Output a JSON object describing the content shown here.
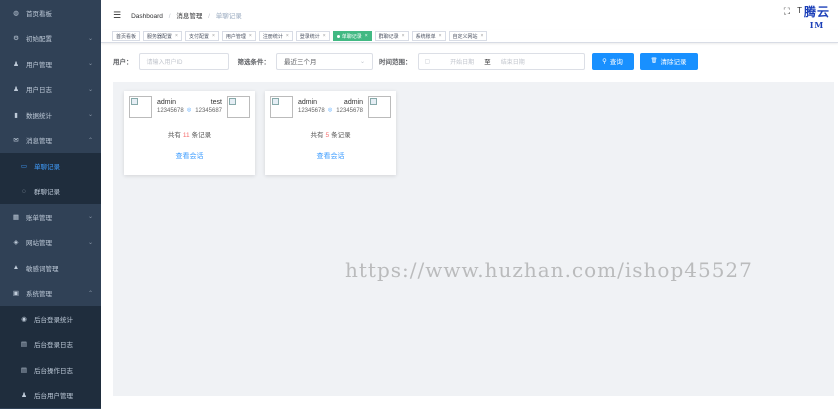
{
  "sidebar": {
    "items": [
      {
        "label": "首页看板",
        "icon": "dashboard-icon",
        "glyph": "◍",
        "chevron": ""
      },
      {
        "label": "初始配置",
        "icon": "settings-icon",
        "glyph": "⚙",
        "chevron": "⌄"
      },
      {
        "label": "用户管理",
        "icon": "user-icon",
        "glyph": "♟",
        "chevron": "⌄"
      },
      {
        "label": "用户日志",
        "icon": "user-log-icon",
        "glyph": "♟",
        "chevron": "⌄"
      },
      {
        "label": "数据统计",
        "icon": "chart-icon",
        "glyph": "▮",
        "chevron": "⌄"
      },
      {
        "label": "消息管理",
        "icon": "message-icon",
        "glyph": "✉",
        "chevron": "⌃"
      },
      {
        "label": "单聊记录",
        "icon": "chat-icon",
        "glyph": "▭",
        "chevron": "",
        "sub": true,
        "active": true
      },
      {
        "label": "群聊记录",
        "icon": "group-chat-icon",
        "glyph": "◌",
        "chevron": "",
        "sub": true
      },
      {
        "label": "账单管理",
        "icon": "bill-icon",
        "glyph": "▦",
        "chevron": "⌄"
      },
      {
        "label": "网站管理",
        "icon": "website-icon",
        "glyph": "◈",
        "chevron": "⌄"
      },
      {
        "label": "敏感词管理",
        "icon": "warning-icon",
        "glyph": "▲",
        "chevron": ""
      },
      {
        "label": "系统管理",
        "icon": "system-icon",
        "glyph": "▣",
        "chevron": "⌃"
      },
      {
        "label": "后台登录统计",
        "icon": "login-stat-icon",
        "glyph": "◉",
        "chevron": "",
        "sub": true
      },
      {
        "label": "后台登录日志",
        "icon": "login-log-icon",
        "glyph": "▤",
        "chevron": "",
        "sub": true
      },
      {
        "label": "后台操作日志",
        "icon": "operation-log-icon",
        "glyph": "▤",
        "chevron": "",
        "sub": true
      },
      {
        "label": "后台用户管理",
        "icon": "admin-user-icon",
        "glyph": "♟",
        "chevron": "",
        "sub": true
      }
    ]
  },
  "navbar": {
    "hamburger": "☰",
    "breadcrumb": [
      "Dashboard",
      "消息管理",
      "单聊记录"
    ],
    "sep": "/",
    "fullscreen": "⛶",
    "textsize": "T",
    "brand_line1": "腾云",
    "brand_line2": "IM"
  },
  "tags": [
    {
      "label": "首页看板",
      "close": ""
    },
    {
      "label": "服务器配置",
      "close": "×"
    },
    {
      "label": "支付配置",
      "close": "×"
    },
    {
      "label": "用户管理",
      "close": "×"
    },
    {
      "label": "注册统计",
      "close": "×"
    },
    {
      "label": "登录统计",
      "close": "×"
    },
    {
      "label": "单聊记录",
      "close": "×",
      "active": true
    },
    {
      "label": "群聊记录",
      "close": "×"
    },
    {
      "label": "系统账单",
      "close": "×"
    },
    {
      "label": "自定义网站",
      "close": "×"
    }
  ],
  "filters": {
    "user_label": "用户：",
    "user_placeholder": "请输入用户ID",
    "condition_label": "筛选条件：",
    "condition_value": "最近三个月",
    "condition_arrow": "⌄",
    "time_label": "时间范围：",
    "start_placeholder": "开始日期",
    "to_text": "至",
    "end_placeholder": "结束日期",
    "calendar_glyph": "▢",
    "search_button": "查询",
    "search_glyph": "⚲",
    "clear_button": "清除记录",
    "clear_glyph": "🗑"
  },
  "cards": [
    {
      "left_name": "admin",
      "left_id": "12345678",
      "right_name": "test",
      "right_id": "12345687",
      "count_prefix": "共有",
      "count": "11",
      "count_suffix": "条记录",
      "link": "查看会话",
      "mid_icon": "◎"
    },
    {
      "left_name": "admin",
      "left_id": "12345678",
      "right_name": "admin",
      "right_id": "12345678",
      "count_prefix": "共有",
      "count": "5",
      "count_suffix": "条记录",
      "link": "查看会话",
      "mid_icon": "◎"
    }
  ],
  "watermark": "https://www.huzhan.com/ishop45527",
  "colors": {
    "sidebar_bg": "#304156",
    "accent": "#409eff",
    "tag_active": "#42b983",
    "button": "#1890ff",
    "count": "#f56c6c"
  }
}
